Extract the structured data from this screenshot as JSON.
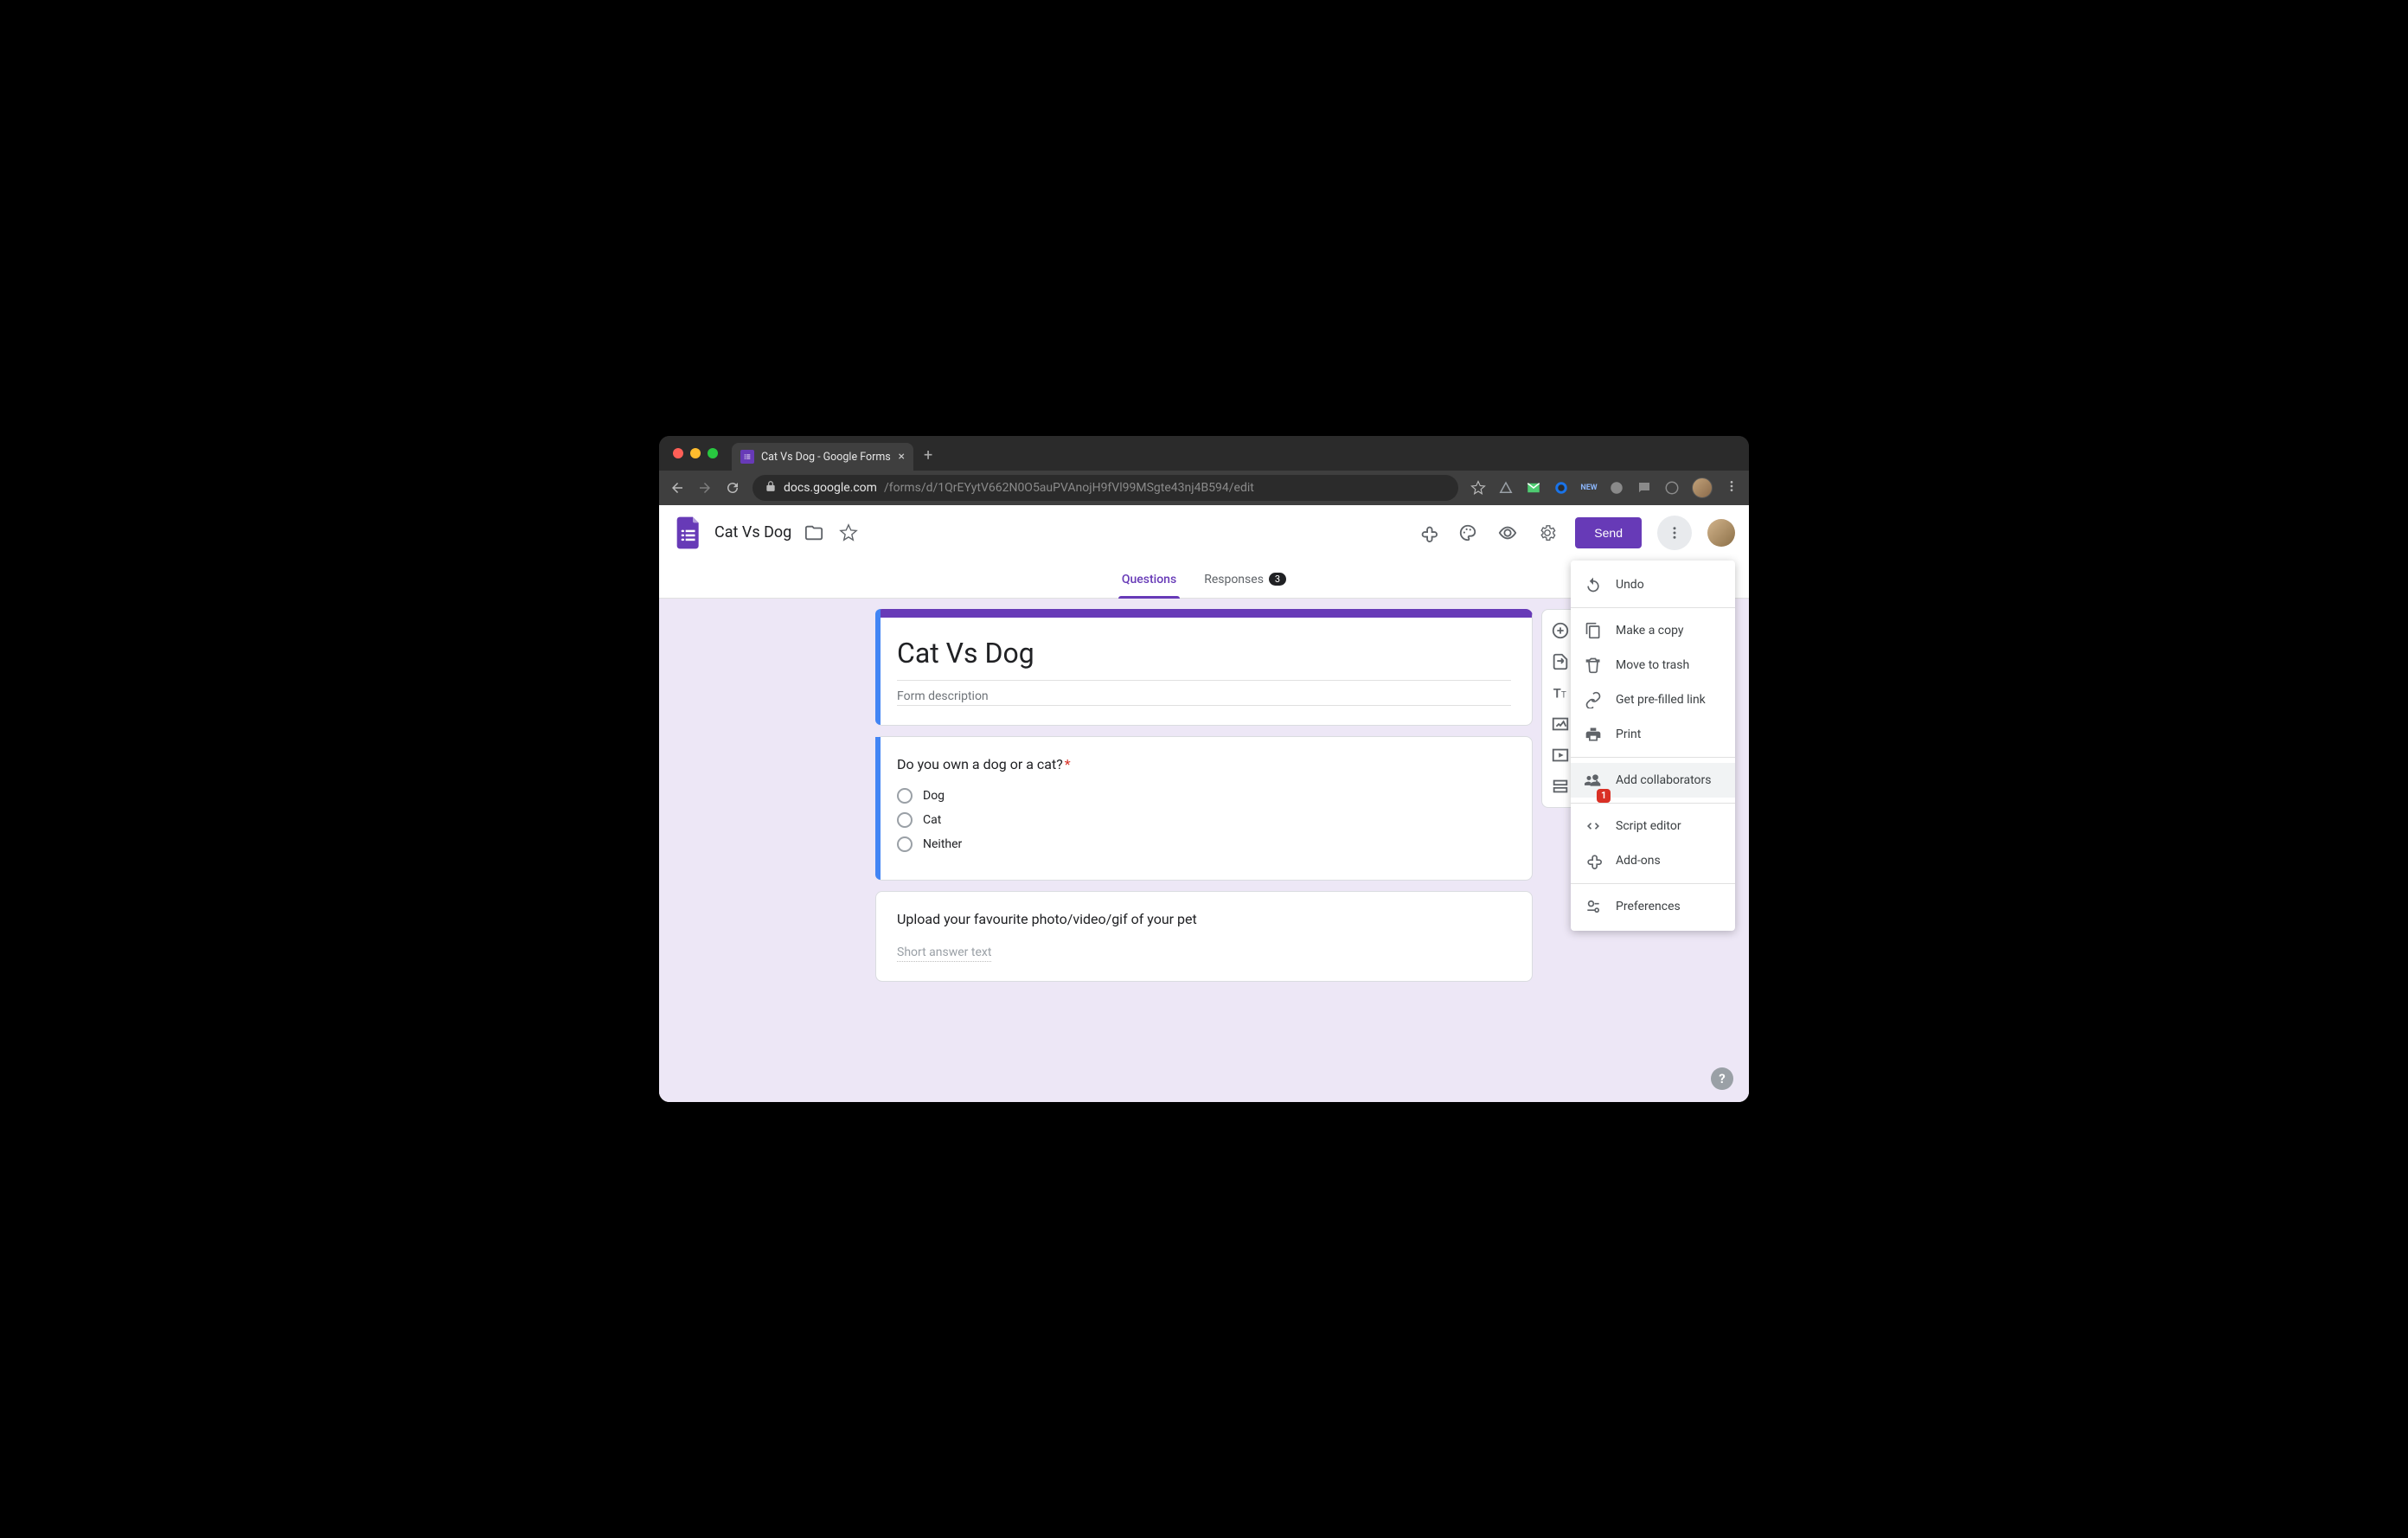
{
  "browser": {
    "tab_title": "Cat Vs Dog - Google Forms",
    "url_host": "docs.google.com",
    "url_path": "/forms/d/1QrEYytV662N0O5auPVAnojH9fVl99MSgte43nj4B594/edit"
  },
  "header": {
    "form_title": "Cat Vs Dog",
    "send_label": "Send"
  },
  "tabs": {
    "questions": "Questions",
    "responses": "Responses",
    "response_count": "3"
  },
  "form": {
    "title": "Cat Vs Dog",
    "description_placeholder": "Form description",
    "q1": {
      "text": "Do you own a dog or a cat?",
      "required": true,
      "options": [
        "Dog",
        "Cat",
        "Neither"
      ]
    },
    "q2": {
      "text": "Upload your favourite photo/video/gif of your pet",
      "answer_placeholder": "Short answer text"
    }
  },
  "menu": {
    "undo": "Undo",
    "make_copy": "Make a copy",
    "move_trash": "Move to trash",
    "prefilled": "Get pre-filled link",
    "print": "Print",
    "collaborators": "Add collaborators",
    "collab_badge": "1",
    "script_editor": "Script editor",
    "addons": "Add-ons",
    "preferences": "Preferences"
  },
  "help": "?"
}
